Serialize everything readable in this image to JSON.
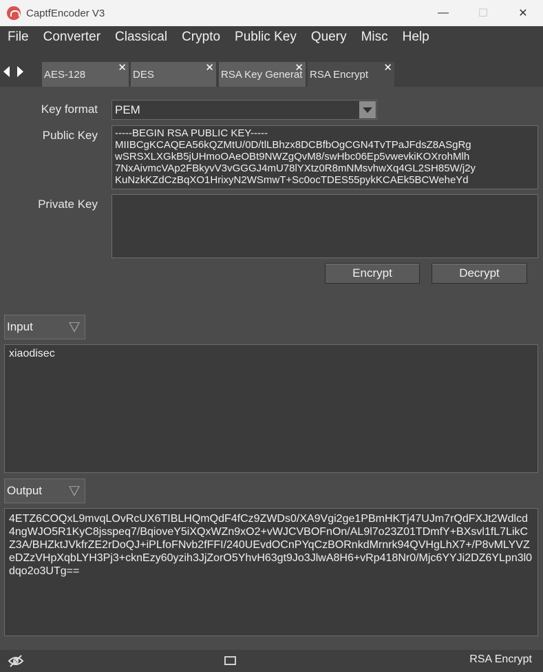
{
  "window": {
    "title": "CaptfEncoder V3",
    "minimize": "—",
    "maximize": "☐",
    "close": "✕"
  },
  "menu": [
    "File",
    "Converter",
    "Classical",
    "Crypto",
    "Public Key",
    "Query",
    "Misc",
    "Help"
  ],
  "tabs": [
    {
      "label": "AES-128",
      "active": false
    },
    {
      "label": "DES",
      "active": false
    },
    {
      "label": "RSA Key Generat",
      "active": false
    },
    {
      "label": "RSA Encrypt",
      "active": true
    }
  ],
  "form": {
    "key_format_label": "Key format",
    "key_format_value": "PEM",
    "public_key_label": "Public Key",
    "public_key_value": "-----BEGIN RSA PUBLIC KEY-----\nMIIBCgKCAQEA56kQZMtU/0D/tlLBhzx8DCBfbOgCGN4TvTPaJFdsZ8ASgRg\nwSRSXLXGkB5jUHmoOAeOBt9NWZgQvM8/swHbc06Ep5vwevkiKOXrohMlh\n7NxAivmcVAp2FBkyvV3vGGGJ4mU78lYXtz0R8mNMsvhwXq4GL2SH85W/j2y\nKuNzkKZdCzBqXO1HrixyN2WSmwT+Sc0ocTDES55pykKCAEk5BCWeheYd",
    "private_key_label": "Private Key",
    "private_key_value": "",
    "encrypt_label": "Encrypt",
    "decrypt_label": "Decrypt"
  },
  "input": {
    "mode_label": "Input",
    "value": "xiaodisec"
  },
  "output": {
    "mode_label": "Output",
    "value": "4ETZ6COQxL9mvqLOvRcUX6TIBLHQmQdF4fCz9ZWDs0/XA9Vgi2ge1PBmHKTj47UJm7rQdFXJt2Wdlcd4ngWJO5R1KyC8jsspeq7/BqioveY5iXQxWZn9xO2+vWJCVBOFnOn/AL9l7o23Z01TDmfY+BXsvl1fL7LikCZ3A/BHZktJVkfrZE2rDoQJ+iPLfoFNvb2fFFI/240UEvdOCnPYqCzBORnkdMrnrk94QVHgLhX7+/P8vMLYVZeDZzVHpXqbLYH3Pj3+cknEzy60yzih3JjZorO5YhvH63gt9Jo3JlwA8H6+vRp418Nr0/Mjc6YYJi2DZ6YLpn3l0dqo2o3UTg=="
  },
  "status": {
    "text": "RSA Encrypt"
  },
  "colors": {
    "background": "#4b4b4b",
    "menubar": "#3f3f3f",
    "field": "#3b3b3b",
    "logo": "#d9534f"
  }
}
